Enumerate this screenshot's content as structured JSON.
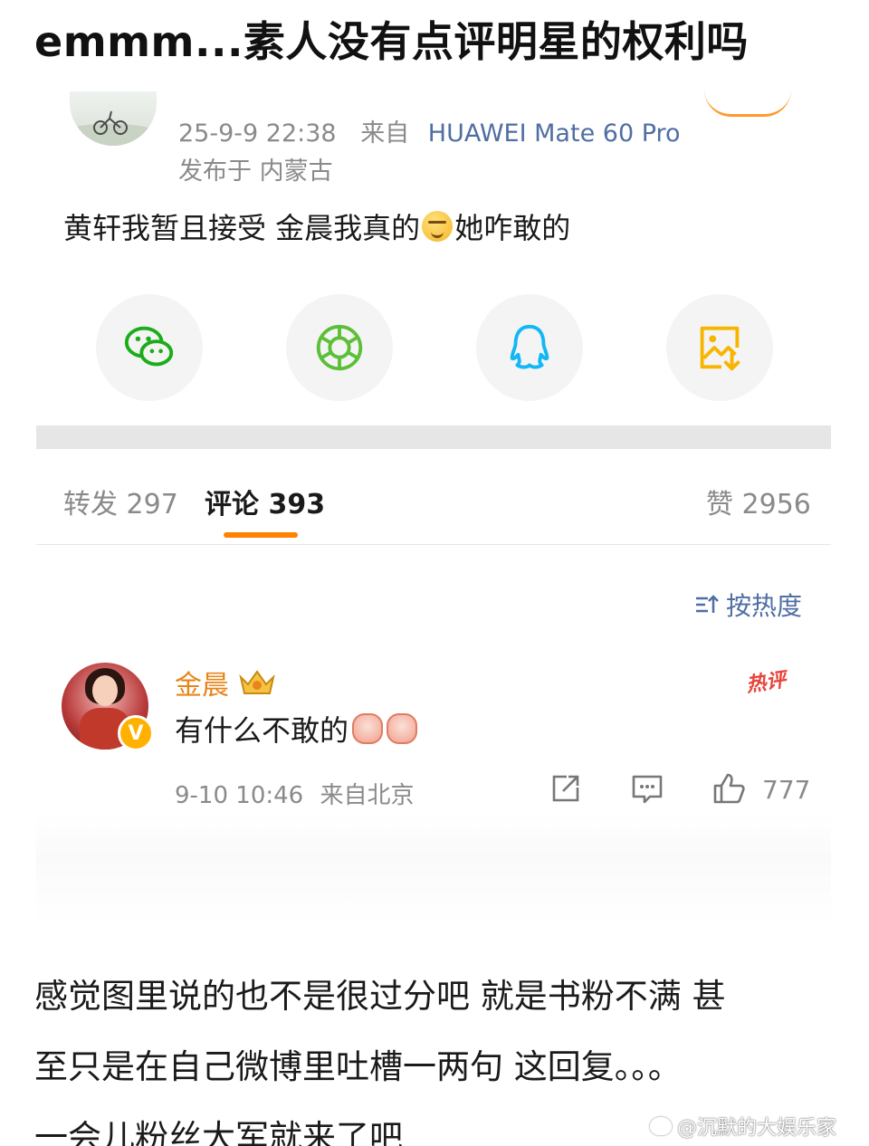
{
  "headline": "emmm...素人没有点评明星的权利吗",
  "post": {
    "time": "25-9-9 22:38",
    "source_prefix": "来自",
    "device": "HUAWEI Mate 60 Pro",
    "location": "发布于 内蒙古",
    "text_before_emoji": "黄轩我暂且接受 金晨我真的",
    "text_after_emoji": "她咋敢的"
  },
  "share_icons": [
    "wechat-icon",
    "moments-icon",
    "qq-icon",
    "save-image-icon"
  ],
  "tabs": {
    "repost_label": "转发 297",
    "comment_label": "评论 393",
    "like_label": "赞 2956"
  },
  "sort": {
    "label": "按热度"
  },
  "comment": {
    "author": "金晨",
    "verified_badge": "V",
    "hot_tag": "热评",
    "text": "有什么不敢的",
    "time": "9-10 10:46",
    "source": "来自北京",
    "like_count": "777"
  },
  "body_lines": [
    "感觉图里说的也不是很过分吧 就是书粉不满 甚",
    "至只是在自己微博里吐槽一两句 这回复。。。",
    "一会儿粉丝大军就来了吧"
  ],
  "watermark": "@沉默的大娱乐家",
  "colors": {
    "accent_orange": "#ff8200",
    "link_blue": "#4f6ea3",
    "name_orange": "#e8841a",
    "wechat_green": "#1aad19",
    "qq_blue": "#12b7f5",
    "save_yellow": "#f7b500"
  }
}
